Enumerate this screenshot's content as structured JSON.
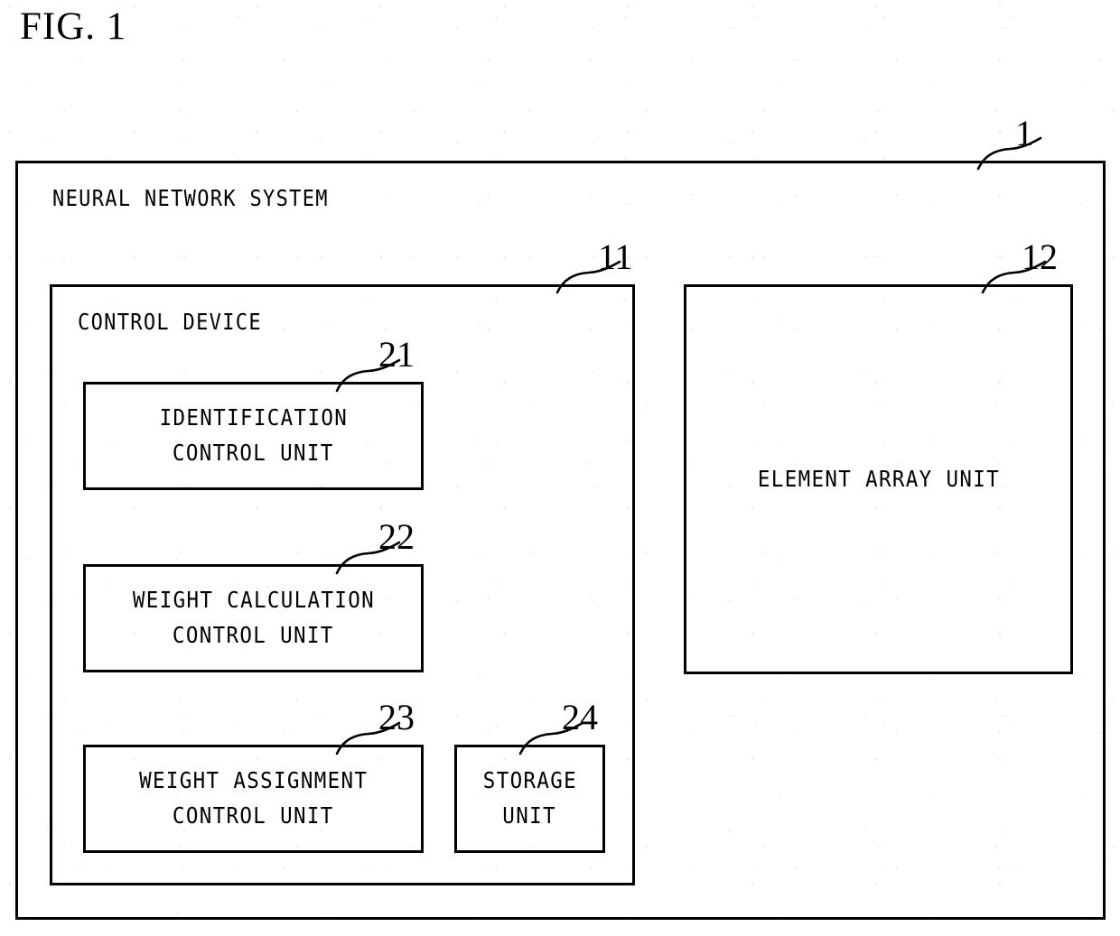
{
  "figure": {
    "title": "FIG. 1",
    "ink_color": "#000000",
    "background_color": "#ffffff"
  },
  "system": {
    "label": "NEURAL NETWORK SYSTEM",
    "ref": "1"
  },
  "control_device": {
    "label": "CONTROL DEVICE",
    "ref": "11"
  },
  "element_array_unit": {
    "label": "ELEMENT ARRAY UNIT",
    "ref": "12"
  },
  "units": [
    {
      "ref": "21",
      "line1": "IDENTIFICATION",
      "line2": "CONTROL UNIT"
    },
    {
      "ref": "22",
      "line1": "WEIGHT CALCULATION",
      "line2": "CONTROL UNIT"
    },
    {
      "ref": "23",
      "line1": "WEIGHT ASSIGNMENT",
      "line2": "CONTROL UNIT"
    },
    {
      "ref": "24",
      "line1": "STORAGE",
      "line2": "UNIT"
    }
  ]
}
